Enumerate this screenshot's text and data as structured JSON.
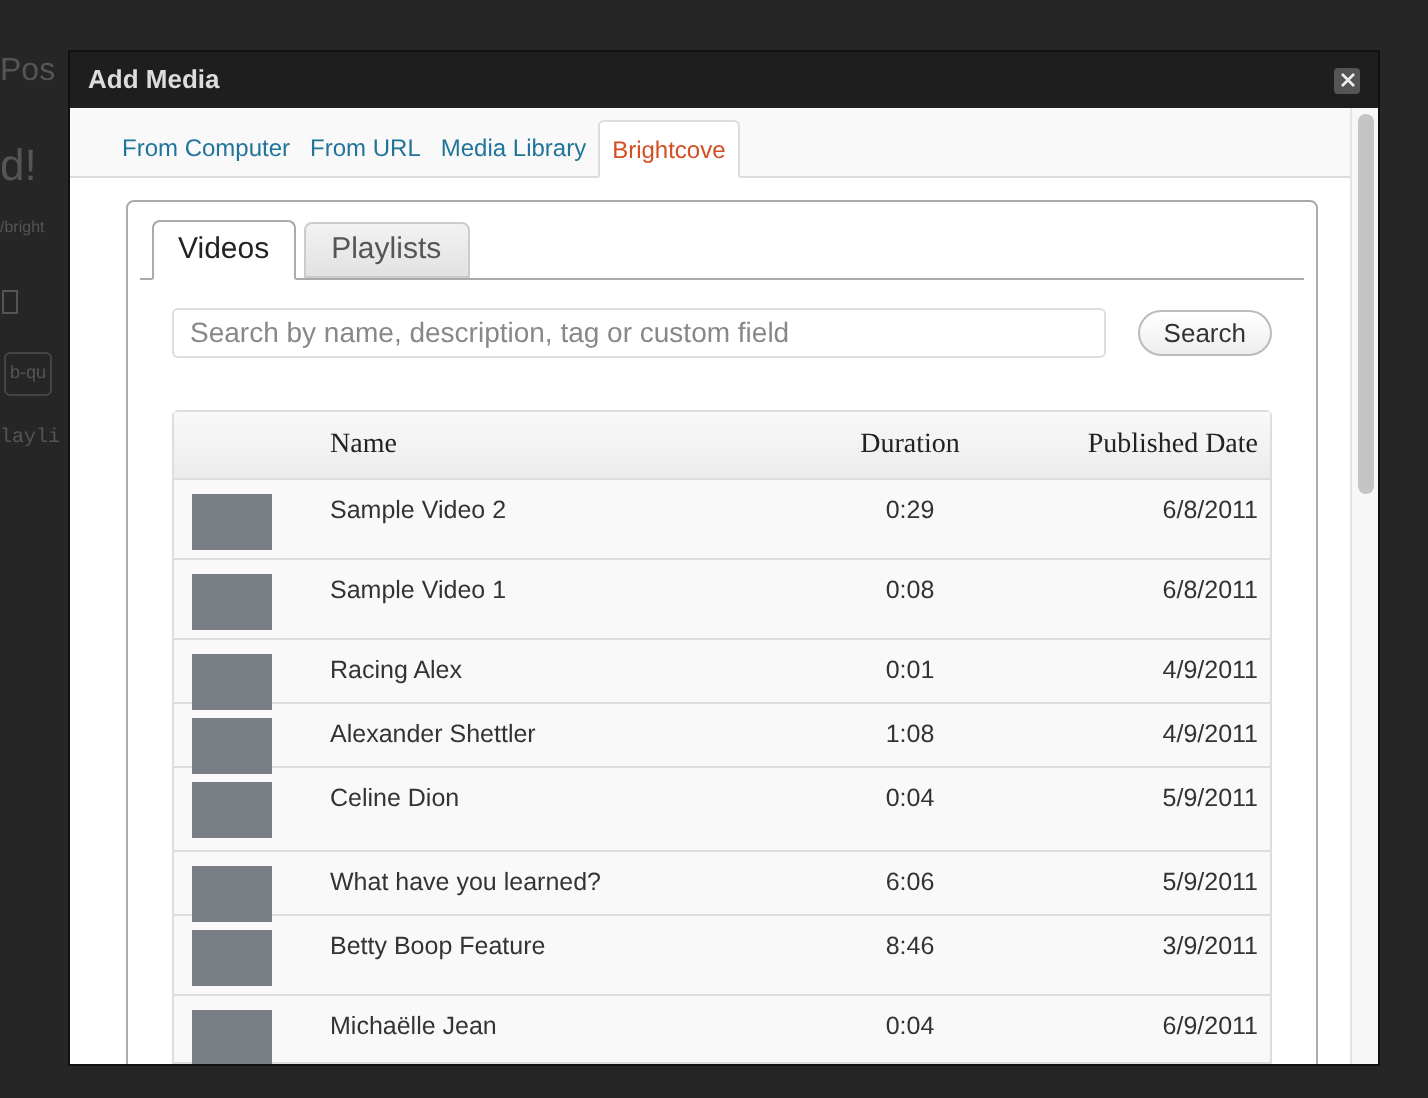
{
  "background_page": {
    "texts": [
      "Pos",
      "d!",
      "/bright",
      "b-qu",
      "layli"
    ]
  },
  "window": {
    "title": "Add Media"
  },
  "tabs": [
    {
      "label": "From Computer",
      "selected": false
    },
    {
      "label": "From URL",
      "selected": false
    },
    {
      "label": "Media Library",
      "selected": false
    },
    {
      "label": "Brightcove",
      "selected": true
    }
  ],
  "subtabs": [
    {
      "label": "Videos",
      "selected": true
    },
    {
      "label": "Playlists",
      "selected": false
    }
  ],
  "search": {
    "placeholder": "Search by name, description, tag or custom field",
    "button": "Search"
  },
  "table": {
    "columns": [
      "Name",
      "Duration",
      "Published Date"
    ],
    "rows": [
      {
        "name": "Sample Video 2",
        "duration": "0:29",
        "published": "6/8/2011"
      },
      {
        "name": "Sample Video 1",
        "duration": "0:08",
        "published": "6/8/2011"
      },
      {
        "name": "Racing Alex",
        "duration": "0:01",
        "published": "4/9/2011"
      },
      {
        "name": "Alexander Shettler",
        "duration": "1:08",
        "published": "4/9/2011"
      },
      {
        "name": "Celine Dion",
        "duration": "0:04",
        "published": "5/9/2011"
      },
      {
        "name": "What have you learned?",
        "duration": "6:06",
        "published": "5/9/2011"
      },
      {
        "name": "Betty Boop Feature",
        "duration": "8:46",
        "published": "3/9/2011"
      },
      {
        "name": "Michaëlle Jean",
        "duration": "0:04",
        "published": "6/9/2011"
      }
    ]
  }
}
